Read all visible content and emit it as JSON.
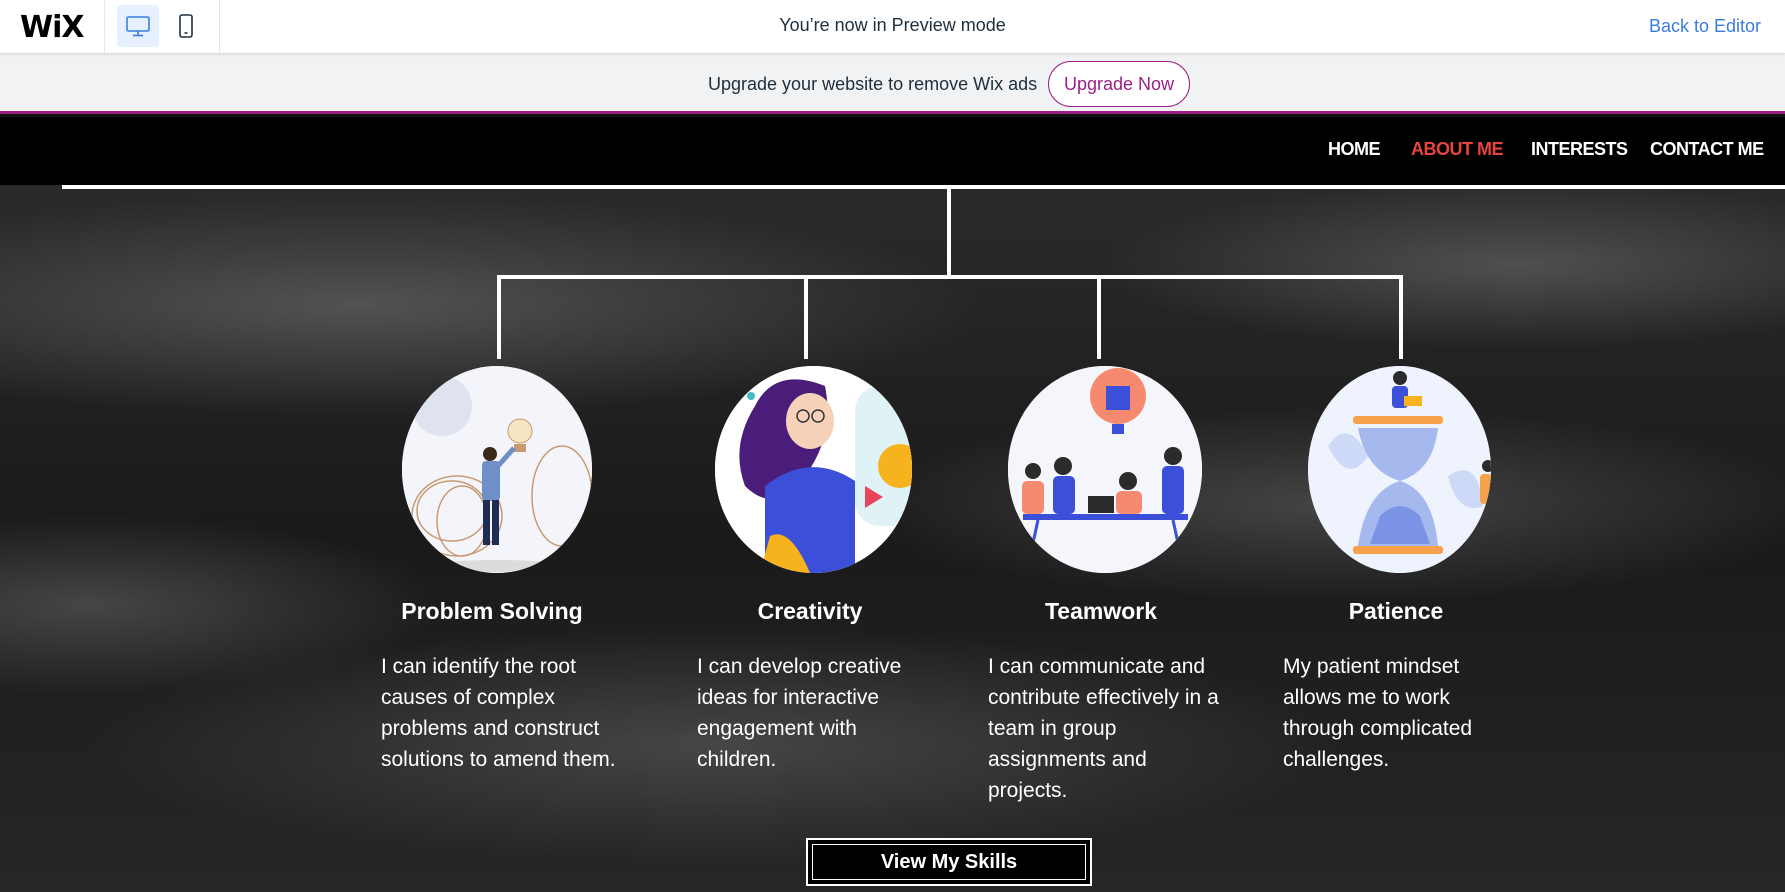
{
  "preview_bar": {
    "logo": "WiX",
    "message": "You’re now in Preview mode",
    "back_link": "Back to Editor",
    "desktop_icon": "desktop-icon",
    "mobile_icon": "mobile-icon"
  },
  "ads_banner": {
    "text": "Upgrade your website to remove Wix ads",
    "button": "Upgrade Now"
  },
  "site_nav": {
    "items": [
      {
        "label": "HOME"
      },
      {
        "label": "ABOUT ME",
        "active": true
      },
      {
        "label": "INTERESTS"
      },
      {
        "label": "CONTACT ME"
      }
    ]
  },
  "skills": [
    {
      "title": "Problem Solving",
      "description": "I can identify the root causes of complex problems and construct solutions to amend them.",
      "image": "lightbulb-idea-illustration"
    },
    {
      "title": "Creativity",
      "description": "I can develop creative ideas for interactive engagement with children.",
      "image": "creative-woman-illustration"
    },
    {
      "title": "Teamwork",
      "description": "I can communicate and contribute effectively in a team in group assignments and projects.",
      "image": "team-meeting-illustration"
    },
    {
      "title": "Patience",
      "description": "My patient mindset allows me to work through complicated challenges.",
      "image": "hourglass-illustration"
    }
  ],
  "cta_button": "View My Skills",
  "colors": {
    "accent": "#9a1f87",
    "nav_active": "#e8443f",
    "link_blue": "#3b7be0"
  }
}
